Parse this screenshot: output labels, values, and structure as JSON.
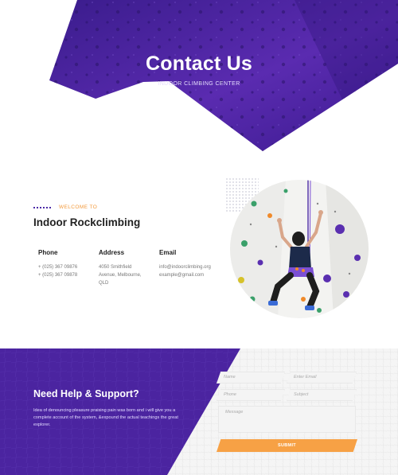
{
  "hero": {
    "title": "Contact Us",
    "subtitle": "INDOOR CLIMBING CENTER"
  },
  "intro": {
    "welcome": "WELCOME TO",
    "title": "Indoor Rockclimbing"
  },
  "contact": {
    "phone": {
      "heading": "Phone",
      "lines": [
        "+ (025) 367 09876",
        "+ (025) 367 09878"
      ]
    },
    "address": {
      "heading": "Address",
      "lines": [
        "4050 Smithfield",
        "Avenue, Melbourne,",
        "QLD"
      ]
    },
    "email": {
      "heading": "Email",
      "lines": [
        "info@indoorclimbing.org",
        "example@gmail.com"
      ]
    }
  },
  "support": {
    "title": "Need Help & Support?",
    "text": "Idea of denouncing pleasure praising pain was born and i will give you a complete account of the system, &expound the actual teachings the great explorer."
  },
  "form": {
    "name_placeholder": "Name",
    "email_placeholder": "Enter Email",
    "phone_placeholder": "Phone",
    "subject_placeholder": "Subject",
    "message_placeholder": "Message",
    "submit_label": "SUBMIT"
  },
  "colors": {
    "brand_purple": "#4b24a0",
    "accent_orange": "#f7a145"
  }
}
